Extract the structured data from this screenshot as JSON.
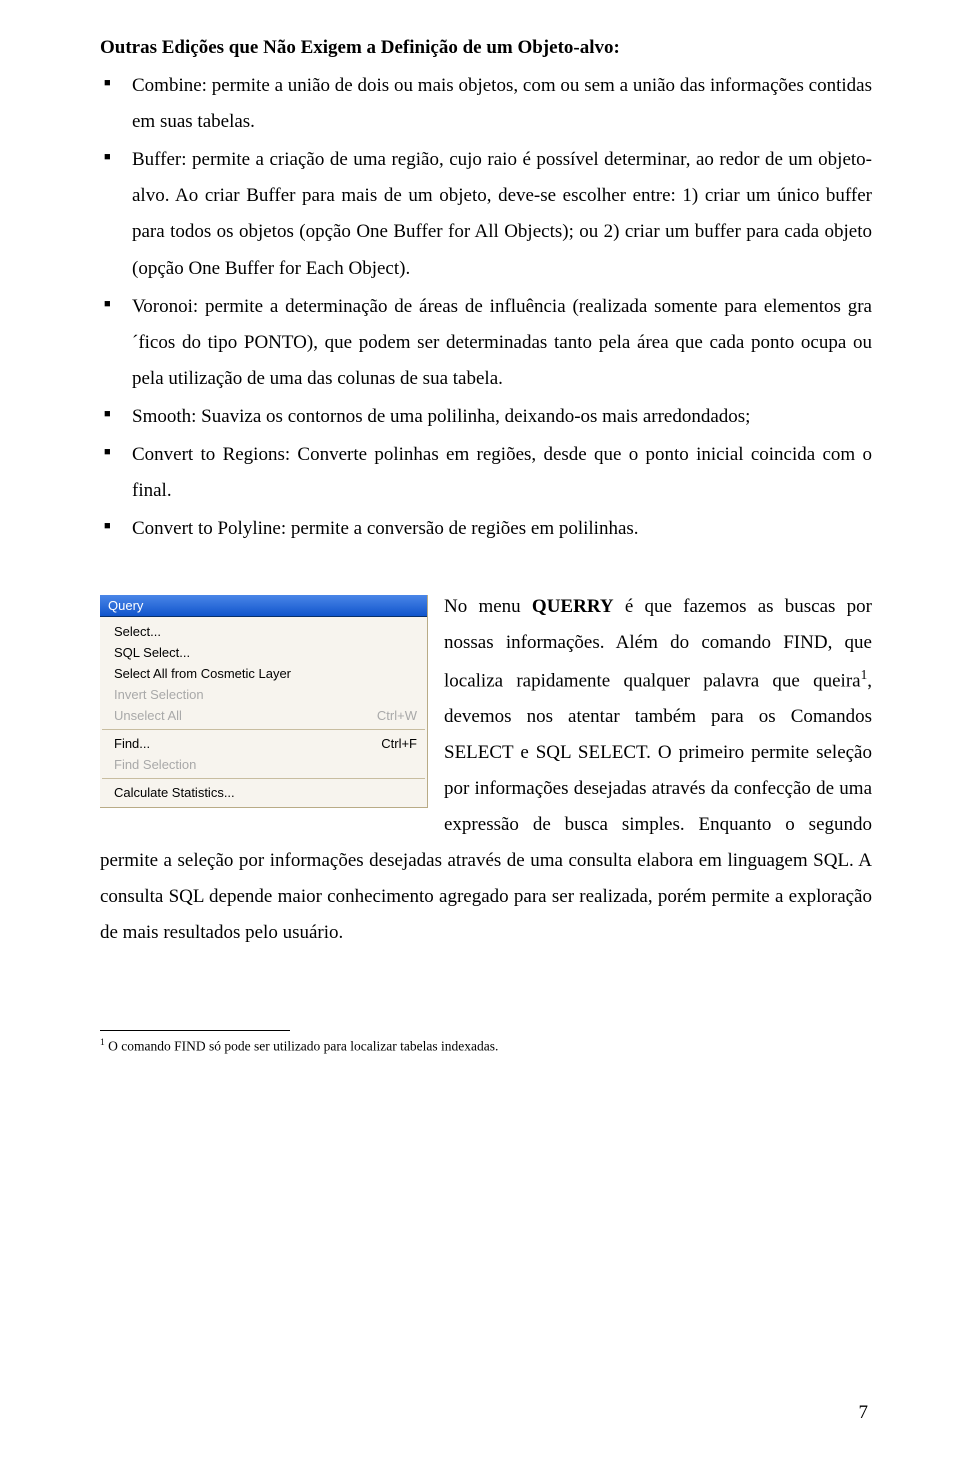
{
  "heading": "Outras Edições que Não Exigem a Definição de um Objeto-alvo:",
  "bullets": [
    "Combine: permite a união de dois ou mais objetos, com ou sem a união das informações contidas em suas tabelas.",
    "Buffer: permite a criação de uma região, cujo raio é possível determinar, ao redor de um objeto-alvo. Ao criar Buffer para mais de um objeto, deve-se escolher entre: 1) criar um único buffer para todos os objetos (opção One Buffer for All Objects); ou 2) criar um buffer para cada objeto (opção One Buffer for Each Object).",
    "Voronoi: permite a determinação de áreas de influência (realizada somente para elementos gra´ficos do tipo PONTO), que podem ser determinadas tanto pela área que cada ponto ocupa ou pela utilização de uma das colunas de sua tabela.",
    "Smooth: Suaviza os contornos de uma polilinha, deixando-os mais arredondados;",
    "Convert to Regions: Converte polinhas em regiões, desde que o ponto inicial coincida com o final.",
    "Convert to Polyline: permite a conversão de regiões em polilinhas."
  ],
  "menu": {
    "title": "Query",
    "items": [
      {
        "label": "Select...",
        "shortcut": "",
        "disabled": false,
        "sepAfter": false
      },
      {
        "label": "SQL Select...",
        "shortcut": "",
        "disabled": false,
        "sepAfter": false
      },
      {
        "label": "Select All from Cosmetic Layer",
        "shortcut": "",
        "disabled": false,
        "sepAfter": false
      },
      {
        "label": "Invert Selection",
        "shortcut": "",
        "disabled": true,
        "sepAfter": false
      },
      {
        "label": "Unselect All",
        "shortcut": "Ctrl+W",
        "disabled": true,
        "sepAfter": true
      },
      {
        "label": "Find...",
        "shortcut": "Ctrl+F",
        "disabled": false,
        "sepAfter": false
      },
      {
        "label": "Find Selection",
        "shortcut": "",
        "disabled": true,
        "sepAfter": true
      },
      {
        "label": "Calculate Statistics...",
        "shortcut": "",
        "disabled": false,
        "sepAfter": false
      }
    ]
  },
  "wrap": {
    "pre": "No menu ",
    "bold": "QUERRY",
    "post1": " é que fazemos as buscas por nossas informações. Além do comando FIND, que localiza rapidamente qualquer palavra que queira",
    "sup": "1",
    "post2": ", devemos nos atentar também para os Comandos SELECT e SQL SELECT. O primeiro permite seleção por informações desejadas através da confecção de uma expressão de busca simples. Enquanto o segundo permite a seleção por informações desejadas através de uma consulta elabora em linguagem SQL. A consulta SQL depende maior conhecimento agregado para ser realizada, porém permite a exploração de mais resultados pelo usuário."
  },
  "footnote": {
    "marker": "1",
    "text": " O comando FIND só pode ser utilizado para localizar tabelas indexadas."
  },
  "pageNumber": "7"
}
